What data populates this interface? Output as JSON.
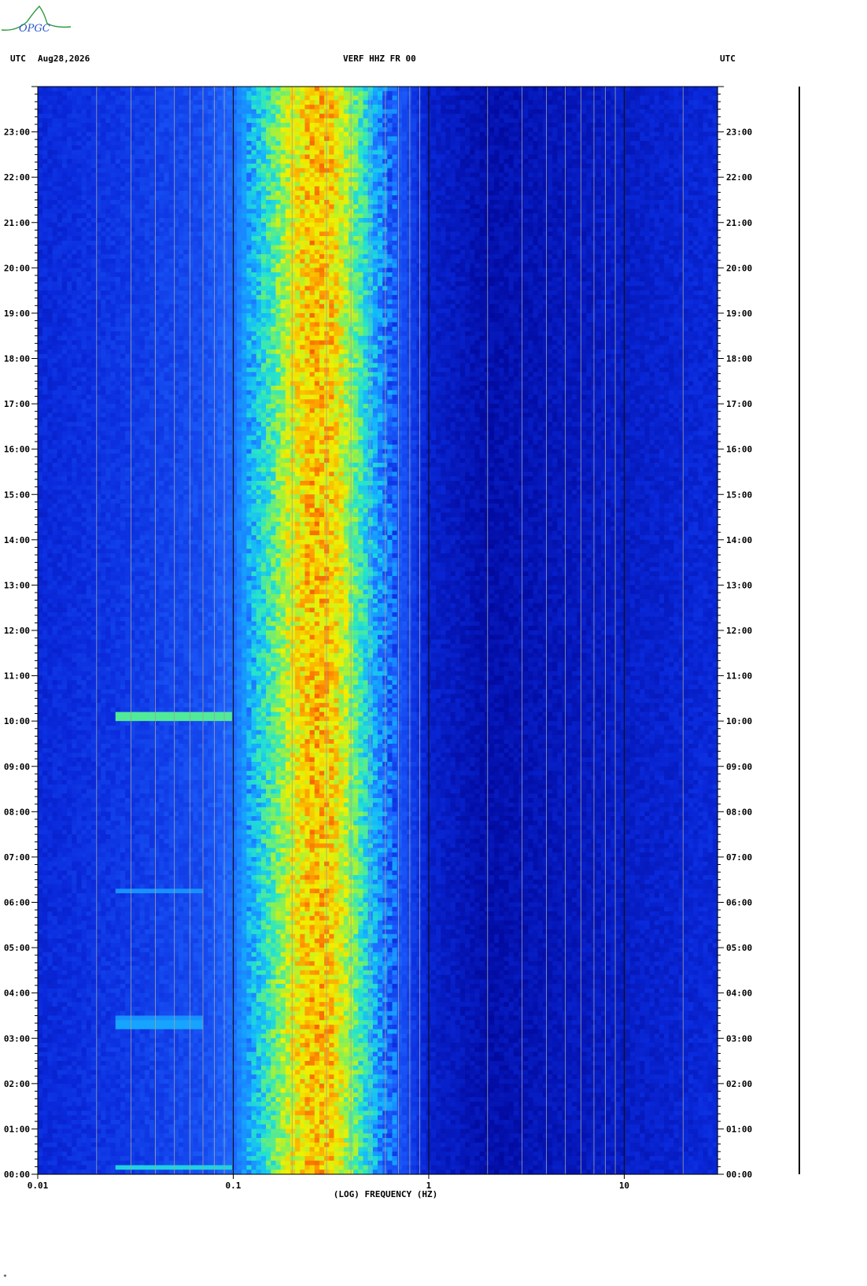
{
  "logo": {
    "text": "OPGC",
    "color": "#2a9a3a"
  },
  "header": {
    "left_tz": "UTC",
    "date": "Aug28,2026",
    "station": "VERF HHZ FR 00",
    "right_tz": "UTC"
  },
  "footer_mark": "*",
  "chart_data": {
    "type": "heatmap",
    "title": "VERF HHZ FR 00",
    "xlabel": "(LOG) FREQUENCY (HZ)",
    "x_scale": "log",
    "xlim": [
      0.01,
      30
    ],
    "x_ticks": [
      {
        "value": 0.01,
        "label": "0.01"
      },
      {
        "value": 0.1,
        "label": "0.1"
      },
      {
        "value": 1,
        "label": "1"
      },
      {
        "value": 10,
        "label": "10"
      }
    ],
    "y_unit": "hours UTC",
    "ylim": [
      0,
      24
    ],
    "y_ticks": [
      "00:00",
      "01:00",
      "02:00",
      "03:00",
      "04:00",
      "05:00",
      "06:00",
      "07:00",
      "08:00",
      "09:00",
      "10:00",
      "11:00",
      "12:00",
      "13:00",
      "14:00",
      "15:00",
      "16:00",
      "17:00",
      "18:00",
      "19:00",
      "20:00",
      "21:00",
      "22:00",
      "23:00"
    ],
    "grid": true,
    "colormap": [
      "#00008c",
      "#0a2adc",
      "#1e64ff",
      "#14b4ff",
      "#28e6c8",
      "#8cf050",
      "#f0f000",
      "#ff9600",
      "#e61e00"
    ],
    "background_color": "#0a1a9e",
    "spectral_profile": [
      {
        "freq": 0.01,
        "level": 0.12
      },
      {
        "freq": 0.025,
        "level": 0.15
      },
      {
        "freq": 0.07,
        "level": 0.2
      },
      {
        "freq": 0.1,
        "level": 0.26
      },
      {
        "freq": 0.12,
        "level": 0.36
      },
      {
        "freq": 0.14,
        "level": 0.45
      },
      {
        "freq": 0.17,
        "level": 0.6
      },
      {
        "freq": 0.2,
        "level": 0.72
      },
      {
        "freq": 0.25,
        "level": 0.82
      },
      {
        "freq": 0.32,
        "level": 0.8
      },
      {
        "freq": 0.4,
        "level": 0.62
      },
      {
        "freq": 0.5,
        "level": 0.42
      },
      {
        "freq": 0.6,
        "level": 0.28
      },
      {
        "freq": 1,
        "level": 0.1
      },
      {
        "freq": 2,
        "level": 0.05
      },
      {
        "freq": 30,
        "level": 0.12
      }
    ],
    "events": [
      {
        "hour": 0.15,
        "fmin": 0.025,
        "fmax": 0.1,
        "level": 0.45
      },
      {
        "hour": 3.3,
        "fmin": 0.025,
        "fmax": 0.07,
        "level": 0.35
      },
      {
        "hour": 3.45,
        "fmin": 0.025,
        "fmax": 0.07,
        "level": 0.32
      },
      {
        "hour": 6.25,
        "fmin": 0.025,
        "fmax": 0.07,
        "level": 0.32
      },
      {
        "hour": 10.1,
        "fmin": 0.025,
        "fmax": 0.1,
        "level": 0.55
      }
    ]
  }
}
